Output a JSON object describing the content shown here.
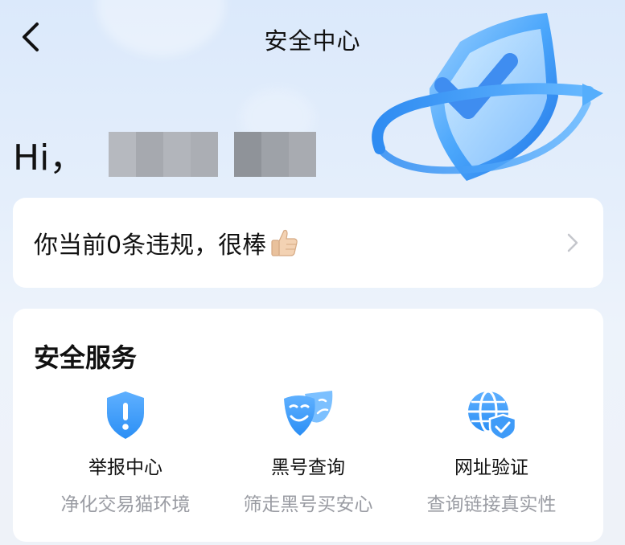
{
  "header": {
    "title": "安全中心",
    "back_icon": "back-arrow-icon"
  },
  "greeting": {
    "prefix": "Hi，"
  },
  "violation": {
    "text": "你当前0条违规，很棒",
    "emoji_icon": "thumbs-up-icon",
    "chevron_icon": "chevron-right-icon"
  },
  "services": {
    "title": "安全服务",
    "items": [
      {
        "icon": "shield-alert-icon",
        "label": "举报中心",
        "desc": "净化交易猫环境"
      },
      {
        "icon": "mask-icon",
        "label": "黑号查询",
        "desc": "筛走黑号买安心"
      },
      {
        "icon": "globe-shield-icon",
        "label": "网址验证",
        "desc": "查询链接真实性"
      }
    ]
  },
  "colors": {
    "accent": "#2b8ff5",
    "accent_light": "#5fb0ff",
    "muted_text": "#9a9ca3",
    "chevron": "#c4c6cc"
  }
}
